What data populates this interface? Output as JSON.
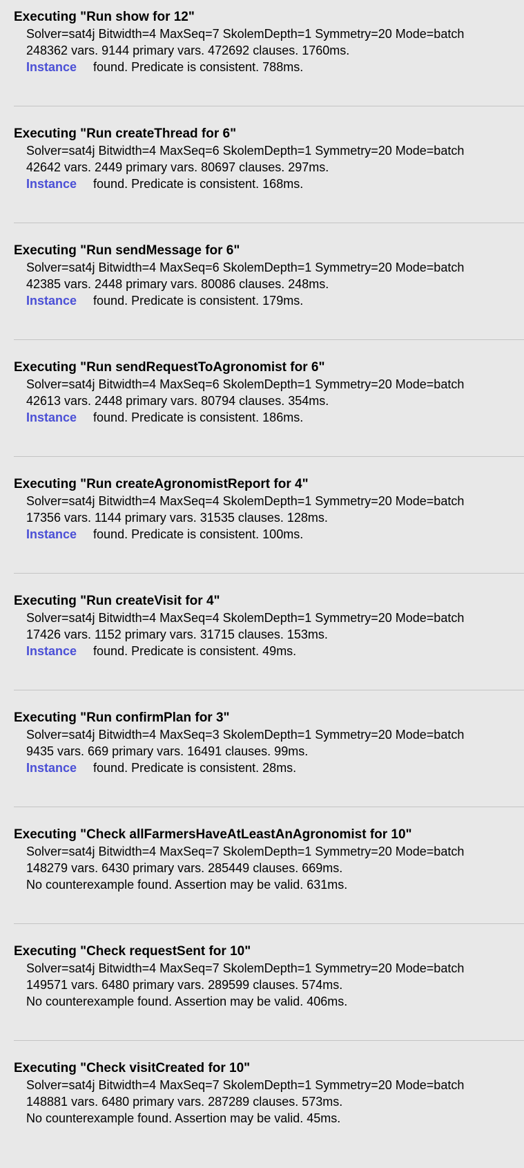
{
  "entries": [
    {
      "title": "Executing \"Run show for 12\"",
      "config": "Solver=sat4j Bitwidth=4 MaxSeq=7 SkolemDepth=1 Symmetry=20 Mode=batch",
      "stats": "248362 vars. 9144 primary vars. 472692 clauses. 1760ms.",
      "link": "Instance",
      "result": "found. Predicate is consistent. 788ms."
    },
    {
      "title": "Executing \"Run createThread for 6\"",
      "config": "Solver=sat4j Bitwidth=4 MaxSeq=6 SkolemDepth=1 Symmetry=20 Mode=batch",
      "stats": "42642 vars. 2449 primary vars. 80697 clauses. 297ms.",
      "link": "Instance",
      "result": "found. Predicate is consistent. 168ms."
    },
    {
      "title": "Executing \"Run sendMessage for 6\"",
      "config": "Solver=sat4j Bitwidth=4 MaxSeq=6 SkolemDepth=1 Symmetry=20 Mode=batch",
      "stats": "42385 vars. 2448 primary vars. 80086 clauses. 248ms.",
      "link": "Instance",
      "result": "found. Predicate is consistent. 179ms."
    },
    {
      "title": "Executing \"Run sendRequestToAgronomist for 6\"",
      "config": "Solver=sat4j Bitwidth=4 MaxSeq=6 SkolemDepth=1 Symmetry=20 Mode=batch",
      "stats": "42613 vars. 2448 primary vars. 80794 clauses. 354ms.",
      "link": "Instance",
      "result": "found. Predicate is consistent. 186ms."
    },
    {
      "title": "Executing \"Run createAgronomistReport for 4\"",
      "config": "Solver=sat4j Bitwidth=4 MaxSeq=4 SkolemDepth=1 Symmetry=20 Mode=batch",
      "stats": "17356 vars. 1144 primary vars. 31535 clauses. 128ms.",
      "link": "Instance",
      "result": "found. Predicate is consistent. 100ms."
    },
    {
      "title": "Executing \"Run createVisit for 4\"",
      "config": "Solver=sat4j Bitwidth=4 MaxSeq=4 SkolemDepth=1 Symmetry=20 Mode=batch",
      "stats": "17426 vars. 1152 primary vars. 31715 clauses. 153ms.",
      "link": "Instance",
      "result": "found. Predicate is consistent. 49ms."
    },
    {
      "title": "Executing \"Run confirmPlan for 3\"",
      "config": "Solver=sat4j Bitwidth=4 MaxSeq=3 SkolemDepth=1 Symmetry=20 Mode=batch",
      "stats": "9435 vars. 669 primary vars. 16491 clauses. 99ms.",
      "link": "Instance",
      "result": "found. Predicate is consistent. 28ms."
    },
    {
      "title": "Executing \"Check allFarmersHaveAtLeastAnAgronomist for 10\"",
      "config": "Solver=sat4j Bitwidth=4 MaxSeq=7 SkolemDepth=1 Symmetry=20 Mode=batch",
      "stats": "148279 vars. 6430 primary vars. 285449 clauses. 669ms.",
      "result": "No counterexample found. Assertion may be valid. 631ms."
    },
    {
      "title": "Executing \"Check requestSent for 10\"",
      "config": "Solver=sat4j Bitwidth=4 MaxSeq=7 SkolemDepth=1 Symmetry=20 Mode=batch",
      "stats": "149571 vars. 6480 primary vars. 289599 clauses. 574ms.",
      "result": "No counterexample found. Assertion may be valid. 406ms."
    },
    {
      "title": "Executing \"Check visitCreated for 10\"",
      "config": "Solver=sat4j Bitwidth=4 MaxSeq=7 SkolemDepth=1 Symmetry=20 Mode=batch",
      "stats": "148881 vars. 6480 primary vars. 287289 clauses. 573ms.",
      "result": "No counterexample found. Assertion may be valid. 45ms."
    }
  ],
  "colors": {
    "background": "#e8e8e8",
    "link": "#4a4fd6",
    "divider": "#c4c4c4",
    "text": "#000000"
  }
}
